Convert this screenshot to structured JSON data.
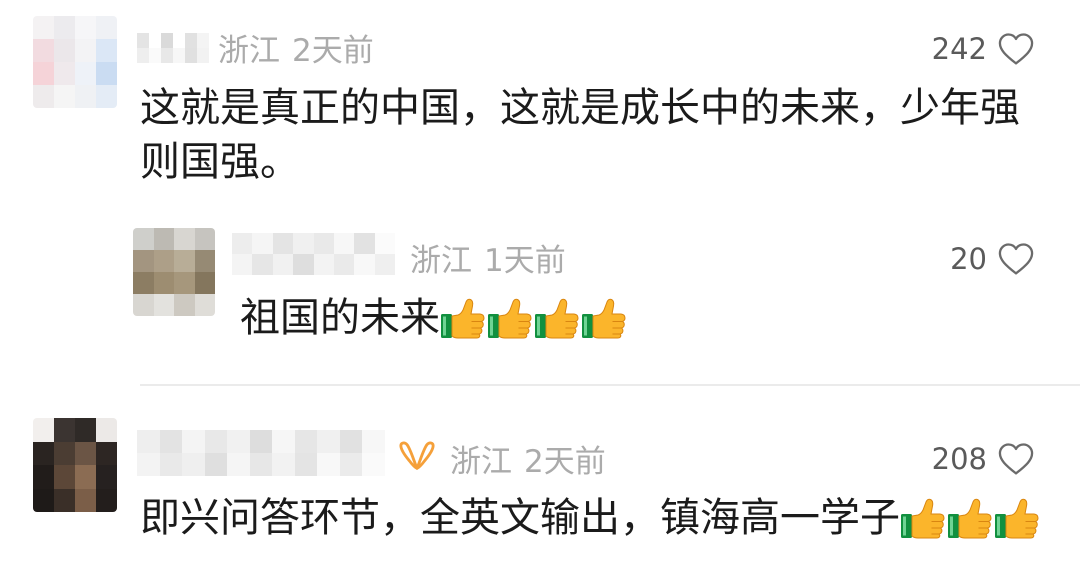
{
  "colors": {
    "background": "#ffffff",
    "text": "#1b1b1b",
    "meta": "#ababab",
    "likes": "#5a5a5a",
    "heart_stroke": "#6b6b6b",
    "divider": "#ebebeb",
    "channels_badge": "#f5a03a"
  },
  "comments": [
    {
      "location": "浙江",
      "time": "2天前",
      "likes": "242",
      "like_icon": "heart-outline-icon",
      "text_lines": [
        "这就是真正的中国，这就是成长中的未来，少年强",
        "则国强。"
      ],
      "replies": [
        {
          "location": "浙江",
          "time": "1天前",
          "likes": "20",
          "like_icon": "heart-outline-icon",
          "text_lines": [
            "祖国的未来"
          ],
          "emojis": [
            "thumbs-up-emoji",
            "thumbs-up-emoji",
            "thumbs-up-emoji",
            "thumbs-up-emoji"
          ]
        }
      ]
    },
    {
      "badge_icon": "wechat-channels-icon",
      "location": "浙江",
      "time": "2天前",
      "likes": "208",
      "like_icon": "heart-outline-icon",
      "text_lines": [
        "即兴问答环节，全英文输出，镇海高一学子"
      ],
      "emojis": [
        "thumbs-up-emoji",
        "thumbs-up-emoji",
        "thumbs-up-emoji"
      ]
    }
  ]
}
